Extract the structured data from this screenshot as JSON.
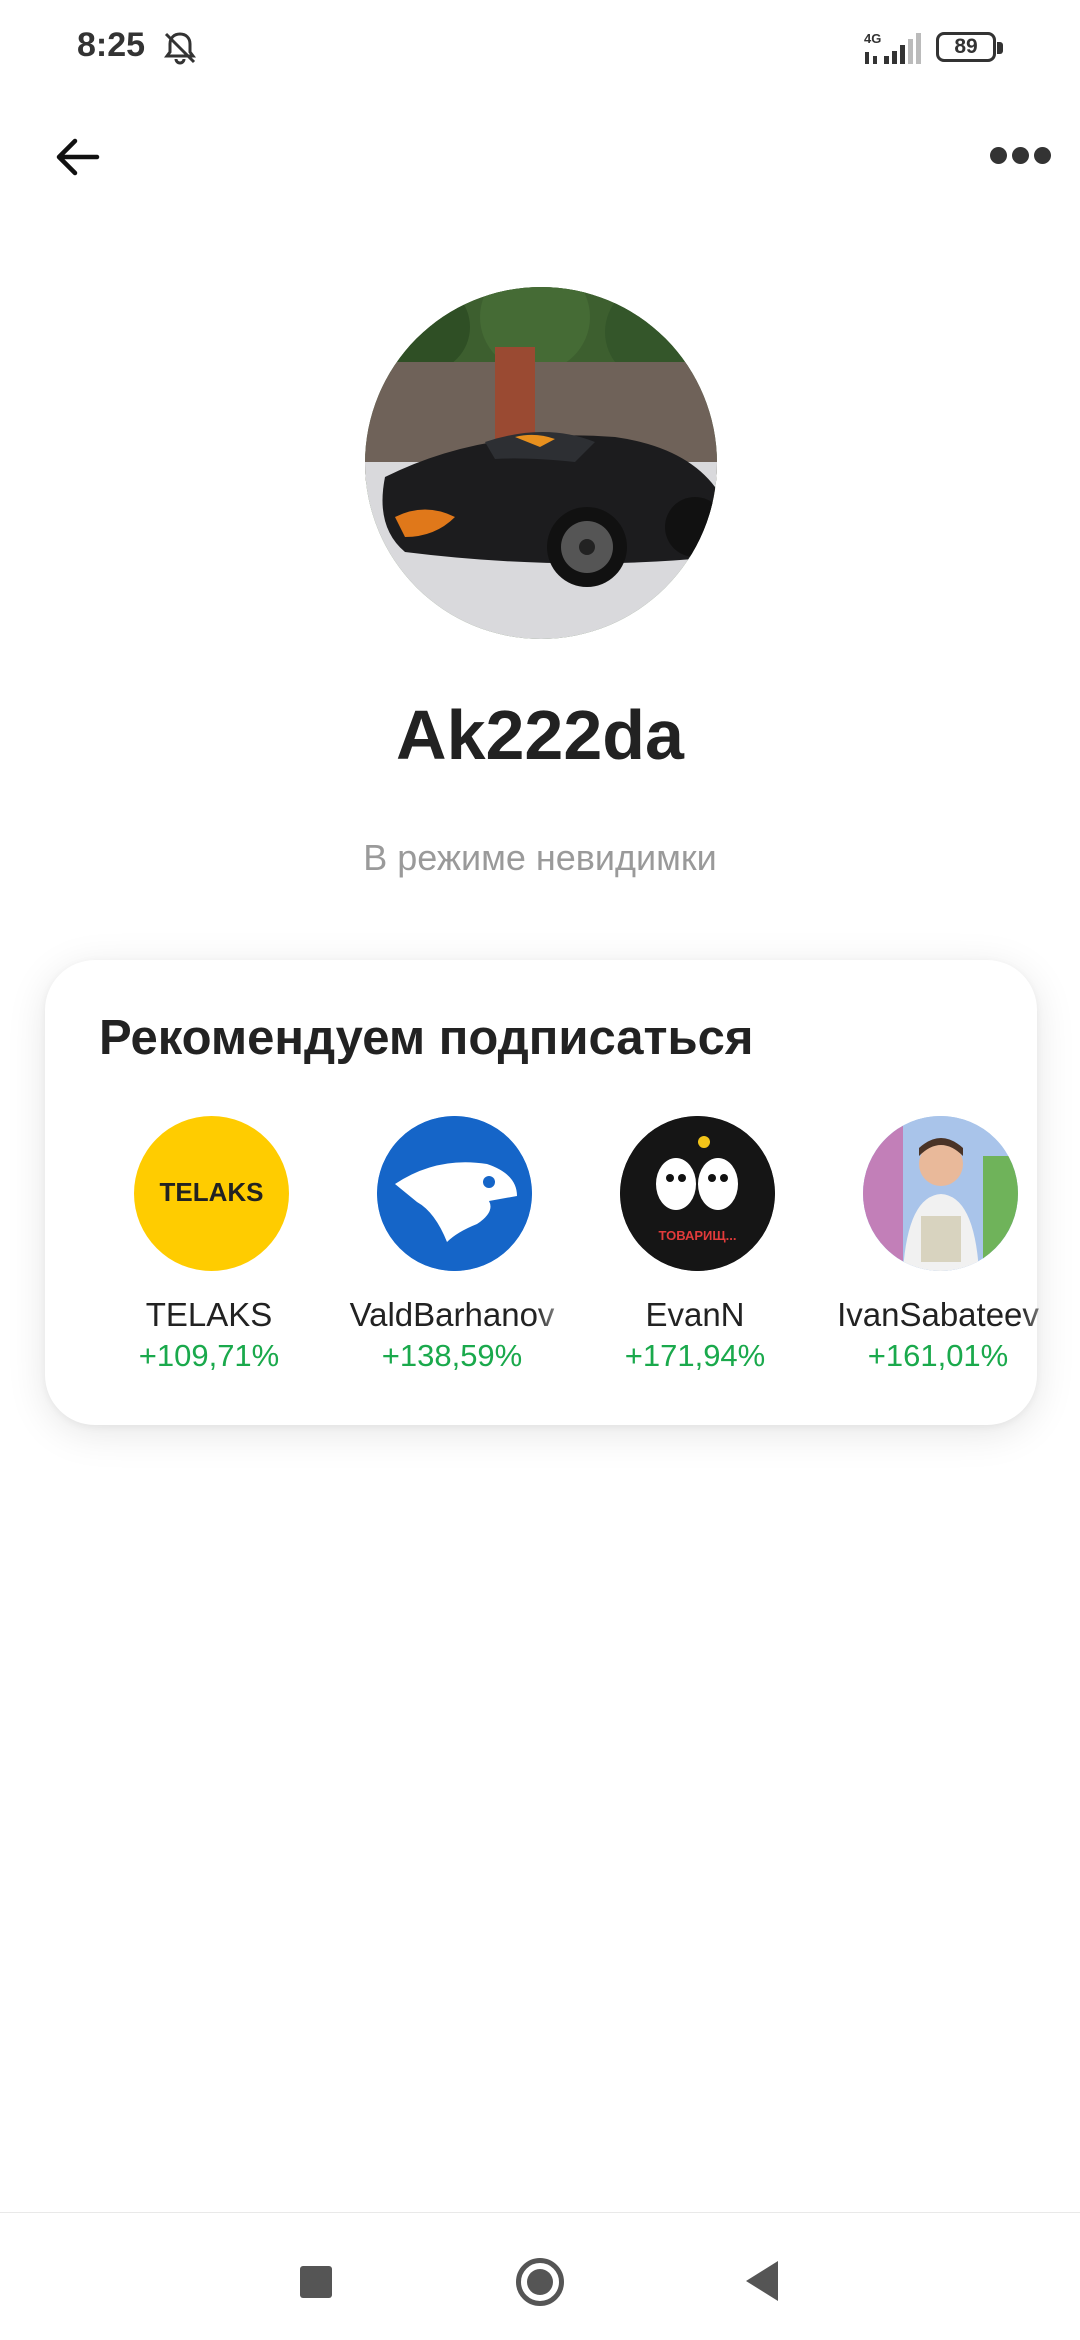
{
  "status_bar": {
    "time": "8:25",
    "network": "4G",
    "battery": "89",
    "icons": [
      "bell-muted-icon",
      "signal-icon",
      "battery-icon"
    ]
  },
  "top_nav": {
    "back_icon": "arrow-left-icon",
    "more_icon": "more-dots-icon"
  },
  "profile": {
    "username": "Ak222da",
    "status": "В режиме невидимки"
  },
  "recommendations": {
    "title": "Рекомендуем подписаться",
    "items": [
      {
        "name": "TELAKS",
        "gain": "+109,71%",
        "logo_text": "TELAKS",
        "avatar_color": "#ffcc00"
      },
      {
        "name": "ValdBarhanov",
        "gain": "+138,59%",
        "avatar_color": "#1e73d8"
      },
      {
        "name": "EvanN",
        "gain": "+171,94%",
        "avatar_color": "#1a1a1a",
        "avatar_caption": "ТОВАРИЩ..."
      },
      {
        "name": "IvanSabateev",
        "gain": "+161,01%",
        "avatar_color": "#9cc0e8"
      }
    ]
  },
  "colors": {
    "gain_green": "#1aa94c",
    "secondary_text": "#9a9a9a"
  }
}
